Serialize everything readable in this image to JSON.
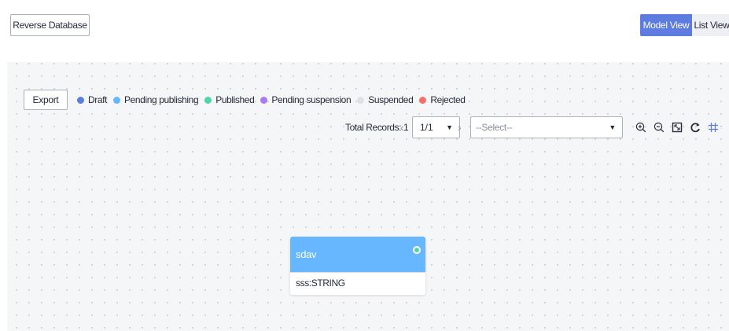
{
  "toolbar": {
    "reverse_db_label": "Reverse Database",
    "model_view_label": "Model View",
    "list_view_label": "List View"
  },
  "legend": {
    "export_label": "Export",
    "items": [
      {
        "label": "Draft",
        "color": "#5e7ce0"
      },
      {
        "label": "Pending publishing",
        "color": "#66b7ff"
      },
      {
        "label": "Published",
        "color": "#50d4ab"
      },
      {
        "label": "Pending suspension",
        "color": "#a97af8"
      },
      {
        "label": "Suspended",
        "color": "#dfe1e6"
      },
      {
        "label": "Rejected",
        "color": "#f66f6a"
      }
    ]
  },
  "pagination": {
    "total_records": "Total Records: 1",
    "prev_icon": "chevron-left-icon",
    "next_icon": "chevron-right-icon",
    "page_value": "1/1",
    "filter_placeholder": "--Select--"
  },
  "tools": [
    {
      "icon": "zoom-in-icon"
    },
    {
      "icon": "zoom-out-icon"
    },
    {
      "icon": "fit-screen-icon"
    },
    {
      "icon": "refresh-icon"
    },
    {
      "icon": "grid-icon"
    }
  ],
  "node": {
    "name": "sdav",
    "status_color": "#50d4ab",
    "field": "sss:STRING"
  },
  "colors": {
    "accent": "#5e7ce0",
    "node_header": "#66b7ff"
  }
}
